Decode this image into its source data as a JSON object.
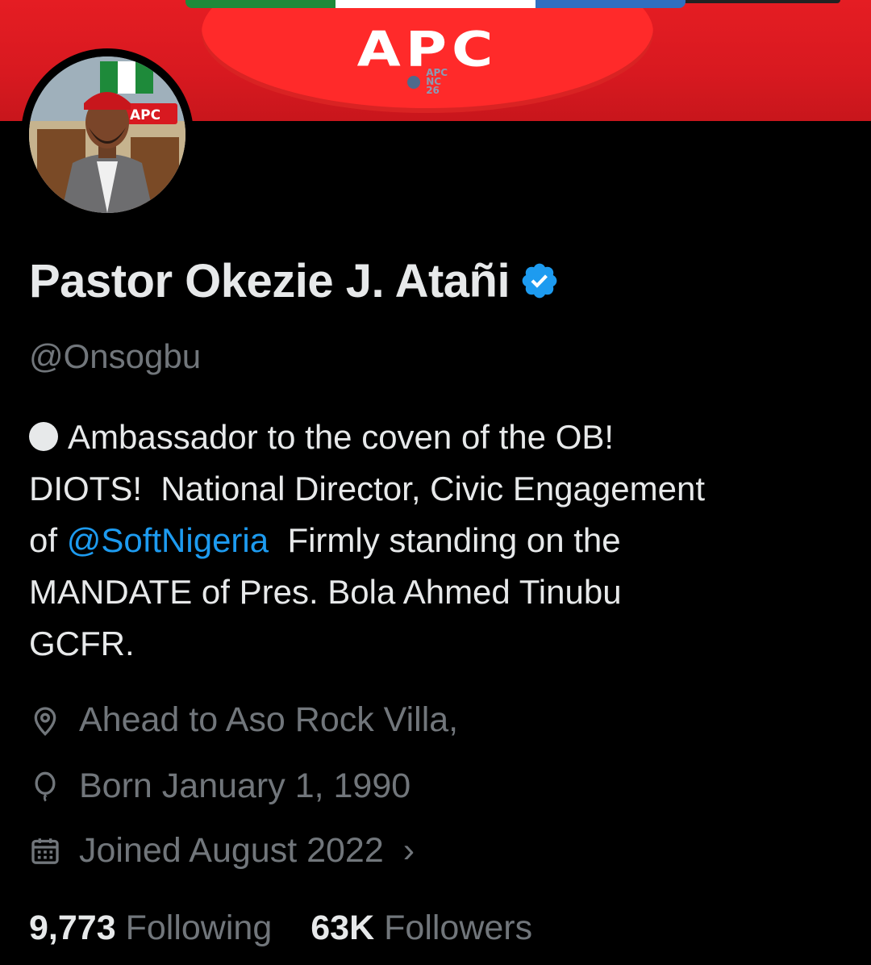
{
  "banner": {
    "logo_text": "APC",
    "sub_text": [
      "APC",
      "NC",
      "26"
    ]
  },
  "avatar": {
    "badge_text": "APC"
  },
  "profile": {
    "display_name": "Pastor Okezie J. Atañi",
    "handle": "@Onsogbu",
    "verified": true
  },
  "bio": {
    "line1": "Ambassador to the coven of the OB!",
    "line2": "DIOTS!  National Director, Civic Engagement",
    "line3_prefix": "of ",
    "line3_mention": "@SoftNigeria",
    "line3_suffix": "  Firmly standing on the",
    "line4": "MANDATE of Pres. Bola Ahmed Tinubu",
    "line5": "GCFR."
  },
  "meta": {
    "location": "Ahead to Aso Rock Villa,",
    "born": "Born January 1, 1990",
    "joined": "Joined August 2022",
    "chevron": "›"
  },
  "stats": {
    "following_count": "9,773",
    "following_label": "Following",
    "followers_count": "63K",
    "followers_label": "Followers"
  },
  "colors": {
    "background": "#000000",
    "text_primary": "#e7e9ea",
    "text_secondary": "#71767b",
    "link": "#1d9bf0",
    "verified": "#1d9bf0",
    "banner_red": "#e51d23"
  },
  "icons": {
    "verified": "verified-badge-icon",
    "location": "location-pin-icon",
    "birthday": "balloon-icon",
    "joined": "calendar-icon",
    "chevron": "chevron-right-icon"
  }
}
